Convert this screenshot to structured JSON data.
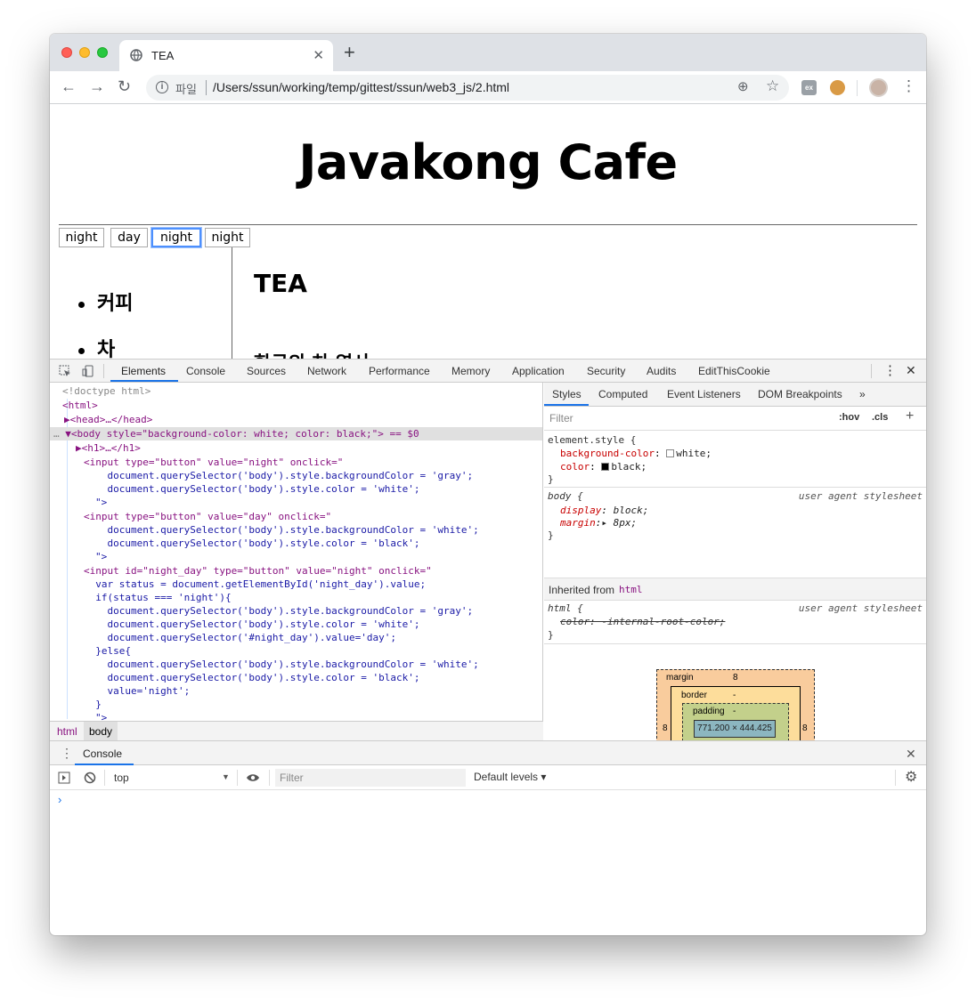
{
  "browser": {
    "tab_title": "TEA",
    "new_tab": "+",
    "tab_close": "✕",
    "url_scheme": "파일",
    "url": "/Users/ssun/working/temp/gittest/ssun/web3_js/2.html",
    "ext_label": "ex"
  },
  "page": {
    "heading": "Javakong Cafe",
    "buttons": [
      "night",
      "day",
      "night",
      "night"
    ],
    "nav_items": [
      "커피",
      "차"
    ],
    "content_title": "TEA",
    "content_subtitle": "한국의 차 역사"
  },
  "devtools": {
    "tabs": [
      "Elements",
      "Console",
      "Sources",
      "Network",
      "Performance",
      "Memory",
      "Application",
      "Security",
      "Audits",
      "EditThisCookie"
    ],
    "breadcrumbs": [
      "html",
      "body"
    ],
    "code": [
      "<!doctype html>",
      "<html>",
      "▶<head>…</head>",
      "▼<body style=\"background-color: white; color: black;\"> == $0",
      "▶<h1>…</h1>",
      "<input type=\"button\" value=\"night\" onclick=\"",
      "    document.querySelector('body').style.backgroundColor = 'gray';",
      "    document.querySelector('body').style.color = 'white';",
      "\">",
      "<input type=\"button\" value=\"day\" onclick=\"",
      "    document.querySelector('body').style.backgroundColor = 'white';",
      "    document.querySelector('body').style.color = 'black';",
      "\">",
      "<input id=\"night_day\" type=\"button\" value=\"night\" onclick=\"",
      "  var status = document.getElementById('night_day').value;",
      "  if(status === 'night'){",
      "    document.querySelector('body').style.backgroundColor = 'gray';",
      "    document.querySelector('body').style.color = 'white';",
      "    document.querySelector('#night_day').value='day';",
      "  }else{",
      "    document.querySelector('body').style.backgroundColor = 'white';",
      "    document.querySelector('body').style.color = 'black';",
      "    value='night';",
      "  }",
      "\">"
    ],
    "styles": {
      "tabs": [
        "Styles",
        "Computed",
        "Event Listeners",
        "DOM Breakpoints",
        "»"
      ],
      "filter_placeholder": "Filter",
      "hov": ":hov",
      "cls": ".cls",
      "add": "+",
      "element_style": "element.style {",
      "element_rules": [
        "background-color: white;",
        "color: black;"
      ],
      "body_rule": "body {",
      "body_props": [
        "display: block;",
        "margin: ▶ 8px;"
      ],
      "ua_label": "user agent stylesheet",
      "close_brace": "}",
      "inherited": "Inherited from",
      "inherited_tag": "html",
      "html_rule": "html {",
      "html_prop": "color: -internal-root-color;",
      "box": {
        "margin_label": "margin",
        "margin_value": "8",
        "border_label": "border",
        "padding_label": "padding",
        "dash": "-",
        "side": "8",
        "content": "771.200 × 444.425"
      }
    },
    "console": {
      "title": "Console",
      "context": "top",
      "filter_placeholder": "Filter",
      "levels": "Default levels ▾",
      "prompt": "›"
    }
  }
}
